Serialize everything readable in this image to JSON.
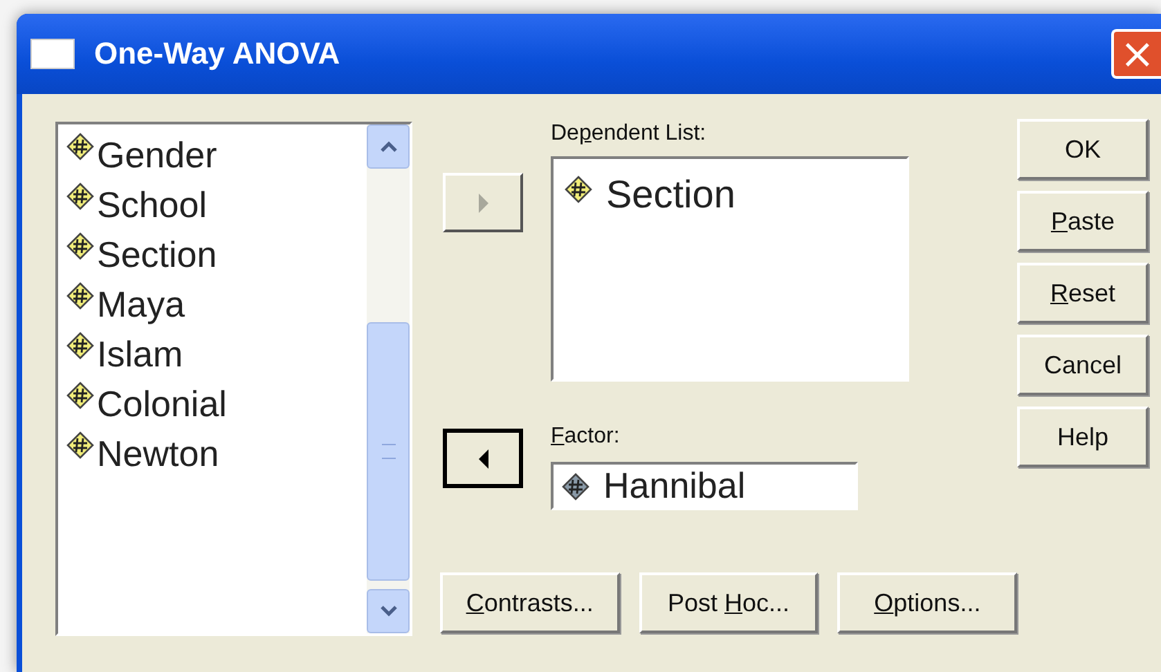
{
  "window": {
    "title": "One-Way ANOVA",
    "close_glyph": "×"
  },
  "variables": [
    {
      "name": "Gender",
      "color": "#f2ee7a"
    },
    {
      "name": "School",
      "color": "#f2ee7a"
    },
    {
      "name": "Section",
      "color": "#f2ee7a"
    },
    {
      "name": "Maya",
      "color": "#f2ee7a"
    },
    {
      "name": "Islam",
      "color": "#f2ee7a"
    },
    {
      "name": "Colonial",
      "color": "#f2ee7a"
    },
    {
      "name": "Newton",
      "color": "#f2ee7a"
    }
  ],
  "move_buttons": [
    {
      "kind": "right",
      "disabled": true,
      "focused": false
    },
    {
      "kind": "left",
      "disabled": false,
      "focused": true
    }
  ],
  "dependent_list": {
    "label": {
      "before": "De",
      "mnemonic": "p",
      "after": "endent List:"
    },
    "items": [
      {
        "name": "Section",
        "color": "#f2ee7a"
      }
    ]
  },
  "factor": {
    "label": {
      "mnemonic": "F",
      "after": "actor:"
    },
    "value": {
      "name": "Hannibal",
      "color": "#8a9aa8"
    }
  },
  "side_buttons": [
    {
      "label": {
        "after": "OK"
      }
    },
    {
      "label": {
        "mnemonic": "P",
        "after": "aste"
      }
    },
    {
      "label": {
        "mnemonic": "R",
        "after": "eset"
      }
    },
    {
      "label": {
        "after": "Cancel"
      }
    },
    {
      "label": {
        "after": "Help"
      }
    }
  ],
  "bottom_buttons": [
    {
      "label": {
        "mnemonic": "C",
        "after": "ontrasts..."
      }
    },
    {
      "label": {
        "before": "Post ",
        "mnemonic": "H",
        "after": "oc..."
      }
    },
    {
      "label": {
        "mnemonic": "O",
        "after": "ptions..."
      }
    }
  ]
}
